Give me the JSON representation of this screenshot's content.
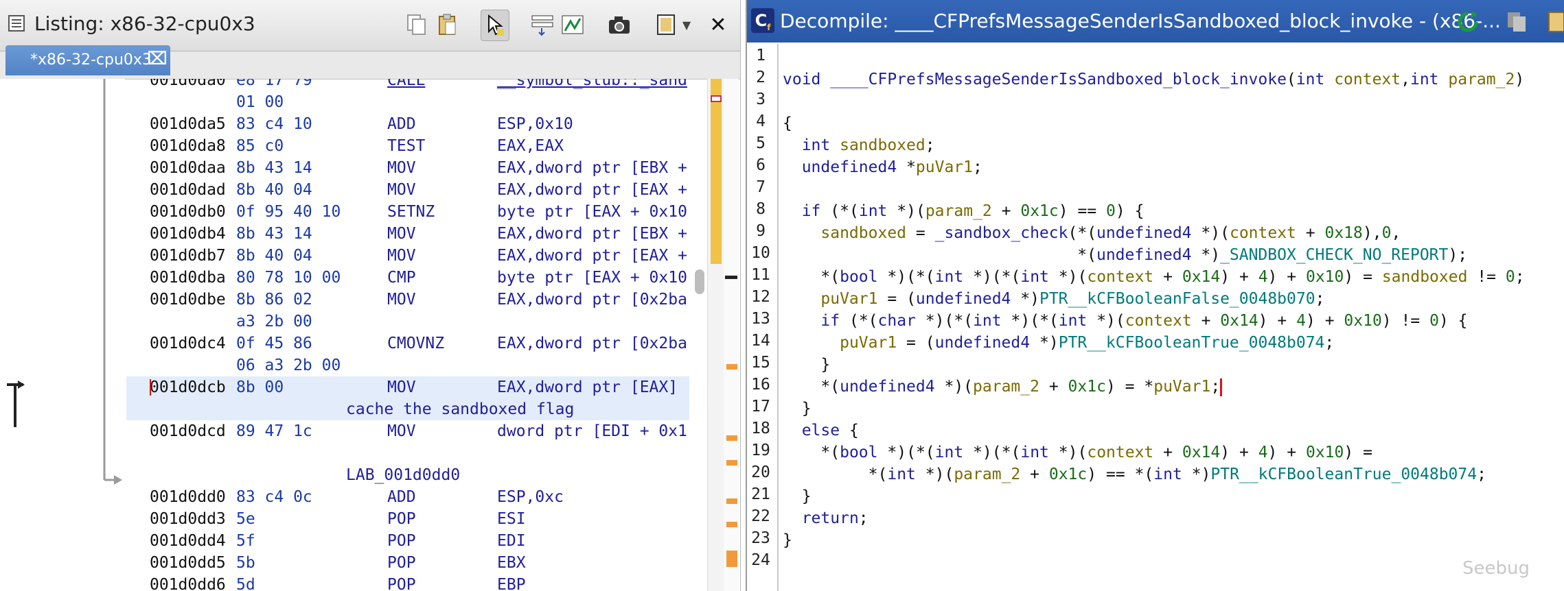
{
  "listing": {
    "title": "Listing: x86-32-cpu0x3",
    "tab": "*x86-32-cpu0x3",
    "tab_close": "⌧",
    "close": "✕",
    "rows": [
      {
        "addr": "001d0da0",
        "bytes": "e8 17 79",
        "mn": "CALL",
        "op": "__symbol_stub::_sand"
      },
      {
        "addr": "",
        "bytes": "01 00",
        "mn": "",
        "op": ""
      },
      {
        "addr": "001d0da5",
        "bytes": "83 c4 10",
        "mn": "ADD",
        "op": "ESP,0x10"
      },
      {
        "addr": "001d0da8",
        "bytes": "85 c0",
        "mn": "TEST",
        "op": "EAX,EAX"
      },
      {
        "addr": "001d0daa",
        "bytes": "8b 43 14",
        "mn": "MOV",
        "op": "EAX,dword ptr [EBX +"
      },
      {
        "addr": "001d0dad",
        "bytes": "8b 40 04",
        "mn": "MOV",
        "op": "EAX,dword ptr [EAX +"
      },
      {
        "addr": "001d0db0",
        "bytes": "0f 95 40 10",
        "mn": "SETNZ",
        "op": "byte ptr [EAX + 0x10"
      },
      {
        "addr": "001d0db4",
        "bytes": "8b 43 14",
        "mn": "MOV",
        "op": "EAX,dword ptr [EBX +"
      },
      {
        "addr": "001d0db7",
        "bytes": "8b 40 04",
        "mn": "MOV",
        "op": "EAX,dword ptr [EAX +"
      },
      {
        "addr": "001d0dba",
        "bytes": "80 78 10 00",
        "mn": "CMP",
        "op": "byte ptr [EAX + 0x10"
      },
      {
        "addr": "001d0dbe",
        "bytes": "8b 86 02",
        "mn": "MOV",
        "op": "EAX,dword ptr [0x2ba"
      },
      {
        "addr": "",
        "bytes": "a3 2b 00",
        "mn": "",
        "op": ""
      },
      {
        "addr": "001d0dc4",
        "bytes": "0f 45 86",
        "mn": "CMOVNZ",
        "op": "EAX,dword ptr [0x2ba"
      },
      {
        "addr": "",
        "bytes": "06 a3 2b 00",
        "mn": "",
        "op": ""
      },
      {
        "addr": "001d0dcb",
        "bytes": "8b 00",
        "mn": "MOV",
        "op": "EAX,dword ptr [EAX]"
      },
      {
        "comment": "cache the sandboxed flag"
      },
      {
        "addr": "001d0dcd",
        "bytes": "89 47 1c",
        "mn": "MOV",
        "op": "dword ptr [EDI + 0x1"
      },
      {
        "blank": true
      },
      {
        "label": "LAB_001d0dd0"
      },
      {
        "addr": "001d0dd0",
        "bytes": "83 c4 0c",
        "mn": "ADD",
        "op": "ESP,0xc"
      },
      {
        "addr": "001d0dd3",
        "bytes": "5e",
        "mn": "POP",
        "op": "ESI"
      },
      {
        "addr": "001d0dd4",
        "bytes": "5f",
        "mn": "POP",
        "op": "EDI"
      },
      {
        "addr": "001d0dd5",
        "bytes": "5b",
        "mn": "POP",
        "op": "EBX"
      },
      {
        "addr": "001d0dd6",
        "bytes": "5d",
        "mn": "POP",
        "op": "EBP"
      }
    ]
  },
  "decompile": {
    "title": "Decompile: ____CFPrefsMessageSenderIsSandboxed_block_invoke - (x86-...",
    "line_numbers": [
      "1",
      "2",
      "3",
      "4",
      "5",
      "6",
      "7",
      "8",
      "9",
      "10",
      "11",
      "12",
      "13",
      "14",
      "15",
      "16",
      "17",
      "18",
      "19",
      "20",
      "21",
      "22",
      "23",
      "24"
    ],
    "lines": [
      "",
      "void ____CFPrefsMessageSenderIsSandboxed_block_invoke(int context,int param_2)",
      "",
      "{",
      "  int sandboxed;",
      "  undefined4 *puVar1;",
      "",
      "  if (*(int *)(param_2 + 0x1c) == 0) {",
      "    sandboxed = _sandbox_check(*(undefined4 *)(context + 0x18),0,",
      "                               *(undefined4 *)_SANDBOX_CHECK_NO_REPORT);",
      "    *(bool *)(*(int *)(*(int *)(context + 0x14) + 4) + 0x10) = sandboxed != 0;",
      "    puVar1 = (undefined4 *)PTR__kCFBooleanFalse_0048b070;",
      "    if (*(char *)(*(int *)(*(int *)(context + 0x14) + 4) + 0x10) != 0) {",
      "      puVar1 = (undefined4 *)PTR__kCFBooleanTrue_0048b074;",
      "    }",
      "    *(undefined4 *)(param_2 + 0x1c) = *puVar1;",
      "  }",
      "  else {",
      "    *(bool *)(*(int *)(*(int *)(context + 0x14) + 4) + 0x10) =",
      "         *(int *)(param_2 + 0x1c) == *(int *)PTR__kCFBooleanTrue_0048b074;",
      "  }",
      "  return;",
      "}",
      ""
    ]
  },
  "watermark": "Seebug",
  "colors": {
    "accent": "#2a58a8",
    "tab": "#5283c5",
    "selection": "#e3ecfa"
  }
}
